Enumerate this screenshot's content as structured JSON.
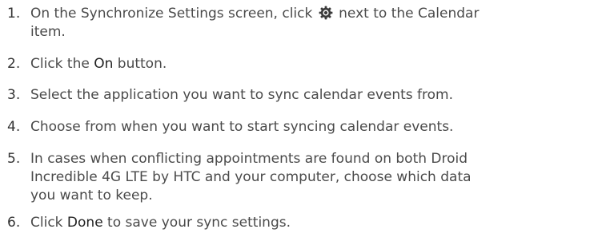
{
  "steps": [
    {
      "number": "1.",
      "line1_before_icon": "On the Synchronize Settings screen, click",
      "line1_after_icon": "next to the Calendar",
      "line2": "item.",
      "icon": "gear-icon"
    },
    {
      "number": "2.",
      "before": "Click the ",
      "keyword": "On",
      "after": " button."
    },
    {
      "number": "3.",
      "text": "Select the application you want to sync calendar events from."
    },
    {
      "number": "4.",
      "text": "Choose from when you want to start syncing calendar events."
    },
    {
      "number": "5.",
      "lines": [
        "In cases when conflicting appointments are found on both Droid",
        "Incredible 4G LTE by HTC and your computer, choose which data",
        "you want to keep."
      ]
    },
    {
      "number": "6.",
      "before": "Click ",
      "keyword": "Done",
      "after": " to save your sync settings."
    }
  ]
}
